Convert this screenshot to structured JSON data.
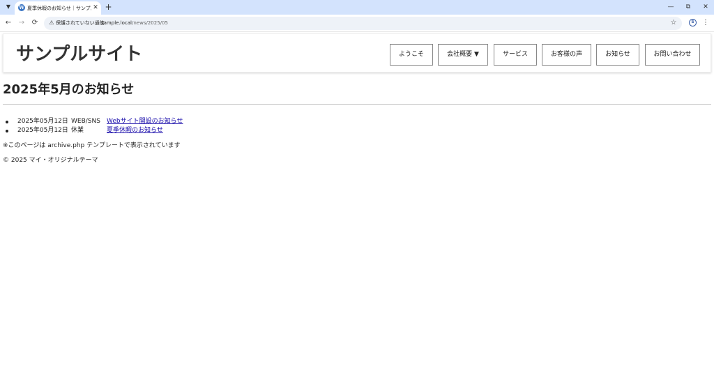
{
  "browser": {
    "tab_title": "夏季休暇のお知らせ｜サンプルサイト",
    "tab_favicon": "W",
    "tab_list_icon": "chevron-down-icon",
    "security_text": "保護されていない通信",
    "url_host": "sample.local",
    "url_path": "/news/2025/05",
    "window_controls": [
      "minimize-icon",
      "restore-icon",
      "close-icon"
    ]
  },
  "header": {
    "site_title": "サンプルサイト",
    "nav": [
      {
        "label": "ようこそ"
      },
      {
        "label": "会社概要 ▼"
      },
      {
        "label": "サービス"
      },
      {
        "label": "お客様の声"
      },
      {
        "label": "お知らせ"
      },
      {
        "label": "お問い合わせ"
      }
    ]
  },
  "main": {
    "archive_title": "2025年5月のお知らせ",
    "posts": [
      {
        "date": "2025年05月12日",
        "category": "WEB/SNS",
        "title": "Webサイト開設のお知らせ"
      },
      {
        "date": "2025年05月12日",
        "category": "休業",
        "title": "夏季休暇のお知らせ"
      }
    ],
    "template_note": "※このページは archive.php テンプレートで表示されています"
  },
  "footer": {
    "copyright": "© 2025 マイ・オリジナルテーマ"
  },
  "colors": {
    "tabstrip_bg": "#d3e3fd",
    "omnibox_bg": "#eef2f8",
    "link": "#1a0dab",
    "title_text": "#333333"
  }
}
